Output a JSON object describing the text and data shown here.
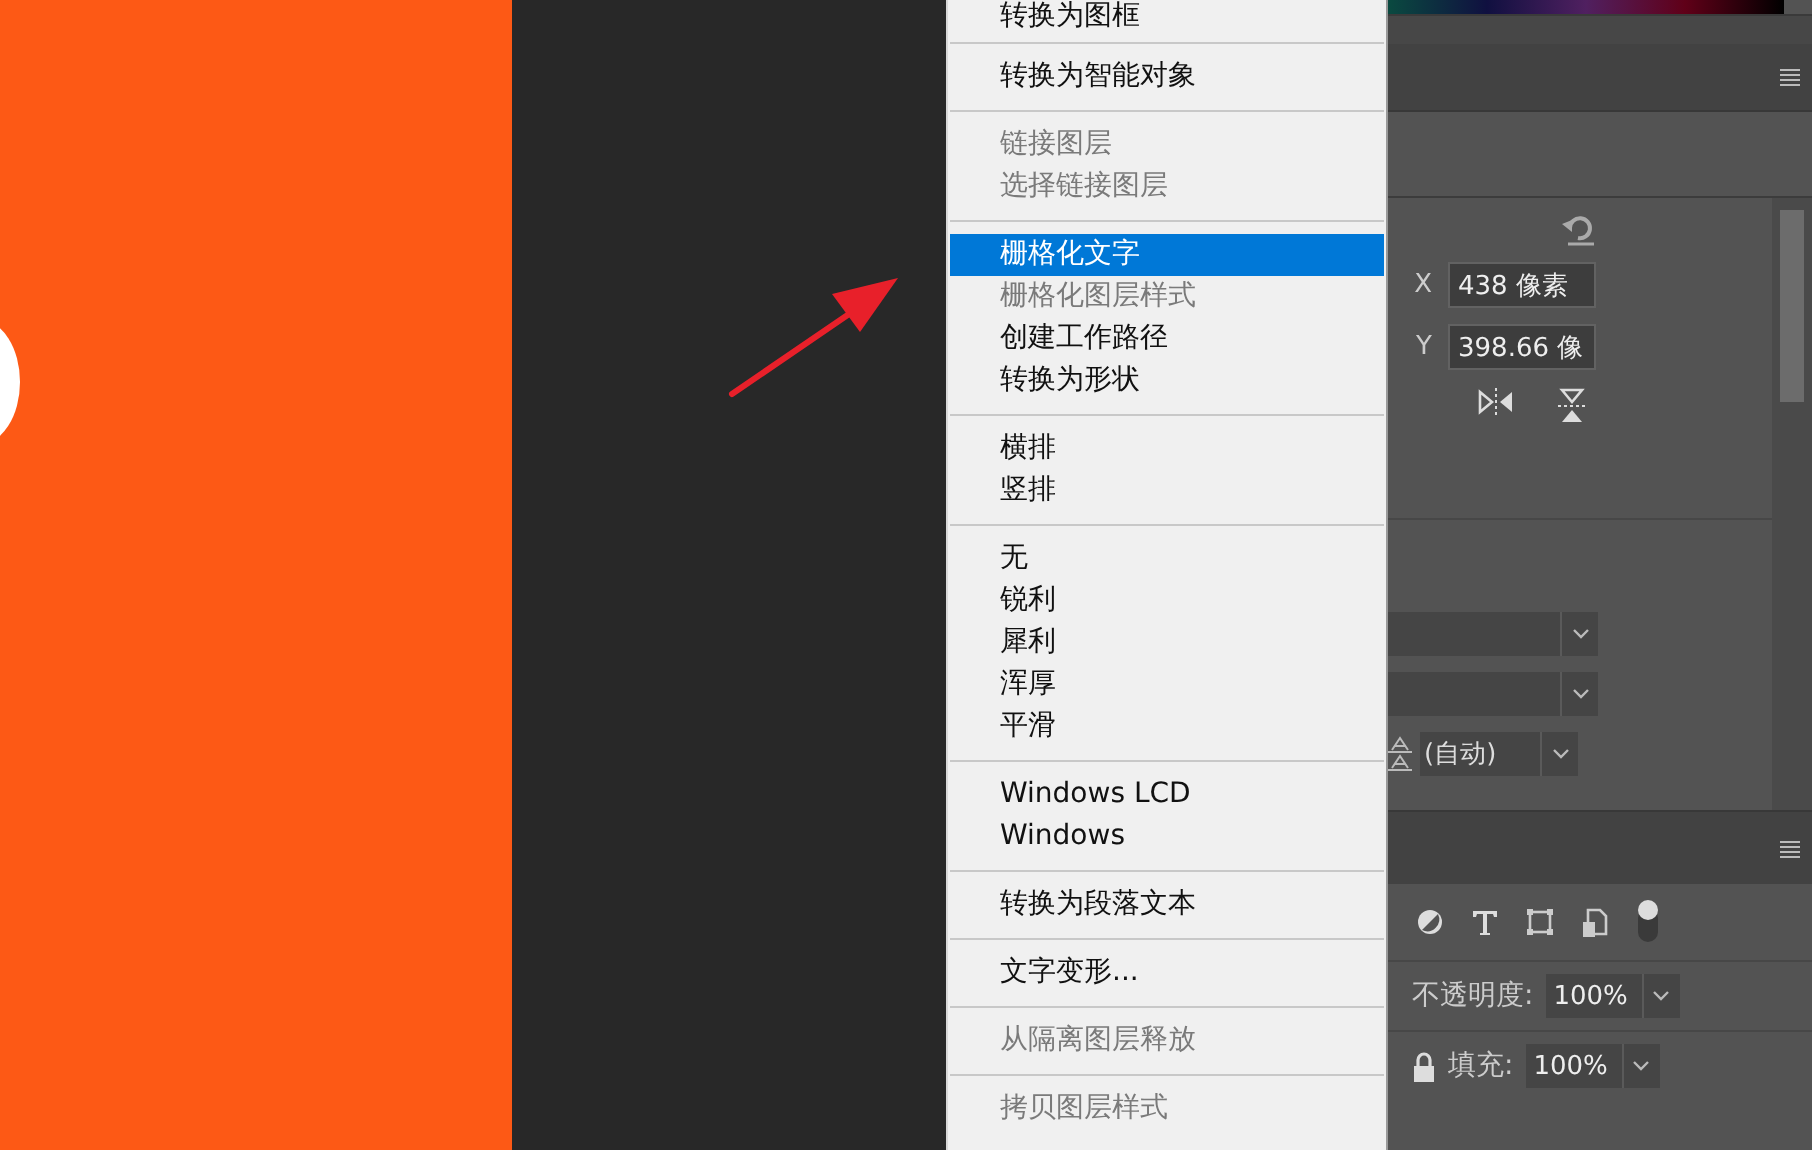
{
  "context_menu": {
    "groups": [
      {
        "items": [
          {
            "label": "转换为图框",
            "disabled": false,
            "selected": false
          }
        ]
      },
      {
        "items": [
          {
            "label": "转换为智能对象",
            "disabled": false,
            "selected": false
          }
        ]
      },
      {
        "items": [
          {
            "label": "链接图层",
            "disabled": true,
            "selected": false
          },
          {
            "label": "选择链接图层",
            "disabled": true,
            "selected": false
          }
        ]
      },
      {
        "items": [
          {
            "label": "栅格化文字",
            "disabled": false,
            "selected": true
          },
          {
            "label": "栅格化图层样式",
            "disabled": true,
            "selected": false
          },
          {
            "label": "创建工作路径",
            "disabled": false,
            "selected": false
          },
          {
            "label": "转换为形状",
            "disabled": false,
            "selected": false
          }
        ]
      },
      {
        "items": [
          {
            "label": "横排",
            "disabled": false,
            "selected": false
          },
          {
            "label": "竖排",
            "disabled": false,
            "selected": false
          }
        ]
      },
      {
        "items": [
          {
            "label": "无",
            "disabled": false,
            "selected": false
          },
          {
            "label": "锐利",
            "disabled": false,
            "selected": false
          },
          {
            "label": "犀利",
            "disabled": false,
            "selected": false
          },
          {
            "label": "浑厚",
            "disabled": false,
            "selected": false
          },
          {
            "label": "平滑",
            "disabled": false,
            "selected": false
          }
        ]
      },
      {
        "items": [
          {
            "label": "Windows LCD",
            "disabled": false,
            "selected": false
          },
          {
            "label": "Windows",
            "disabled": false,
            "selected": false
          }
        ]
      },
      {
        "items": [
          {
            "label": "转换为段落文本",
            "disabled": false,
            "selected": false
          }
        ]
      },
      {
        "items": [
          {
            "label": "文字变形...",
            "disabled": false,
            "selected": false
          }
        ]
      },
      {
        "items": [
          {
            "label": "从隔离图层释放",
            "disabled": true,
            "selected": false
          }
        ]
      },
      {
        "items": [
          {
            "label": "拷贝图层样式",
            "disabled": true,
            "selected": false
          }
        ]
      }
    ]
  },
  "properties_panel": {
    "x_label": "X",
    "x_value": "438 像素",
    "y_label": "Y",
    "y_value": "398.66 像"
  },
  "character_panel": {
    "leading_value": "(自动)"
  },
  "layers_panel": {
    "opacity_label": "不透明度:",
    "opacity_value": "100%",
    "fill_label": "填充:",
    "fill_value": "100%"
  }
}
